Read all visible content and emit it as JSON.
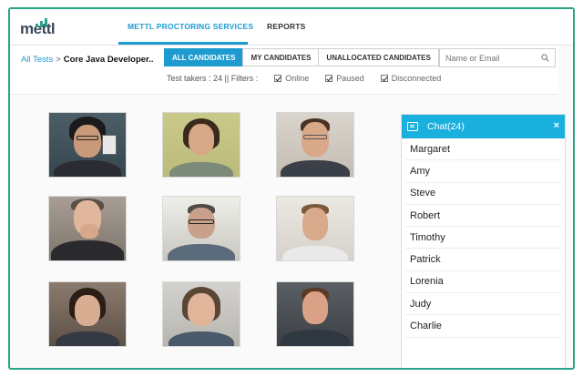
{
  "app": {
    "logo_text": "mettl"
  },
  "nav": {
    "tabs": [
      {
        "label": "METTL PROCTORING SERVICES",
        "active": true
      },
      {
        "label": "REPORTS",
        "active": false
      }
    ]
  },
  "breadcrumb": {
    "root": "All Tests",
    "separator": ">",
    "current": "Core Java Developer.."
  },
  "candidate_tabs": [
    {
      "label": "ALL CANDIDATES",
      "active": true
    },
    {
      "label": "MY CANDIDATES",
      "active": false
    },
    {
      "label": "UNALLOCATED CANDIDATES",
      "active": false
    }
  ],
  "search": {
    "placeholder": "Name or Email",
    "value": ""
  },
  "filters": {
    "summary": "Test takers : 24 || Filters :",
    "options": [
      {
        "label": "Online",
        "checked": true
      },
      {
        "label": "Paused",
        "checked": true
      },
      {
        "label": "Disconnected",
        "checked": true
      }
    ]
  },
  "video_tiles": [
    {
      "id": "cand-1",
      "row": 1,
      "col": 1
    },
    {
      "id": "cand-2",
      "row": 1,
      "col": 2
    },
    {
      "id": "cand-3",
      "row": 1,
      "col": 3
    },
    {
      "id": "cand-4",
      "row": 2,
      "col": 1
    },
    {
      "id": "cand-5",
      "row": 2,
      "col": 2
    },
    {
      "id": "cand-6",
      "row": 2,
      "col": 3
    },
    {
      "id": "cand-7",
      "row": 3,
      "col": 1
    },
    {
      "id": "cand-8",
      "row": 3,
      "col": 2
    },
    {
      "id": "cand-9",
      "row": 3,
      "col": 3
    }
  ],
  "chat": {
    "title": "Chat(24)",
    "close_icon": "close-icon",
    "participants": [
      "Margaret",
      "Amy",
      "Steve",
      "Robert",
      "Timothy",
      "Patrick",
      "Lorenia",
      "Judy",
      "Charlie"
    ]
  },
  "colors": {
    "accent": "#1d9bd1",
    "chat_header": "#1ab0de",
    "frame": "#2aa389"
  }
}
